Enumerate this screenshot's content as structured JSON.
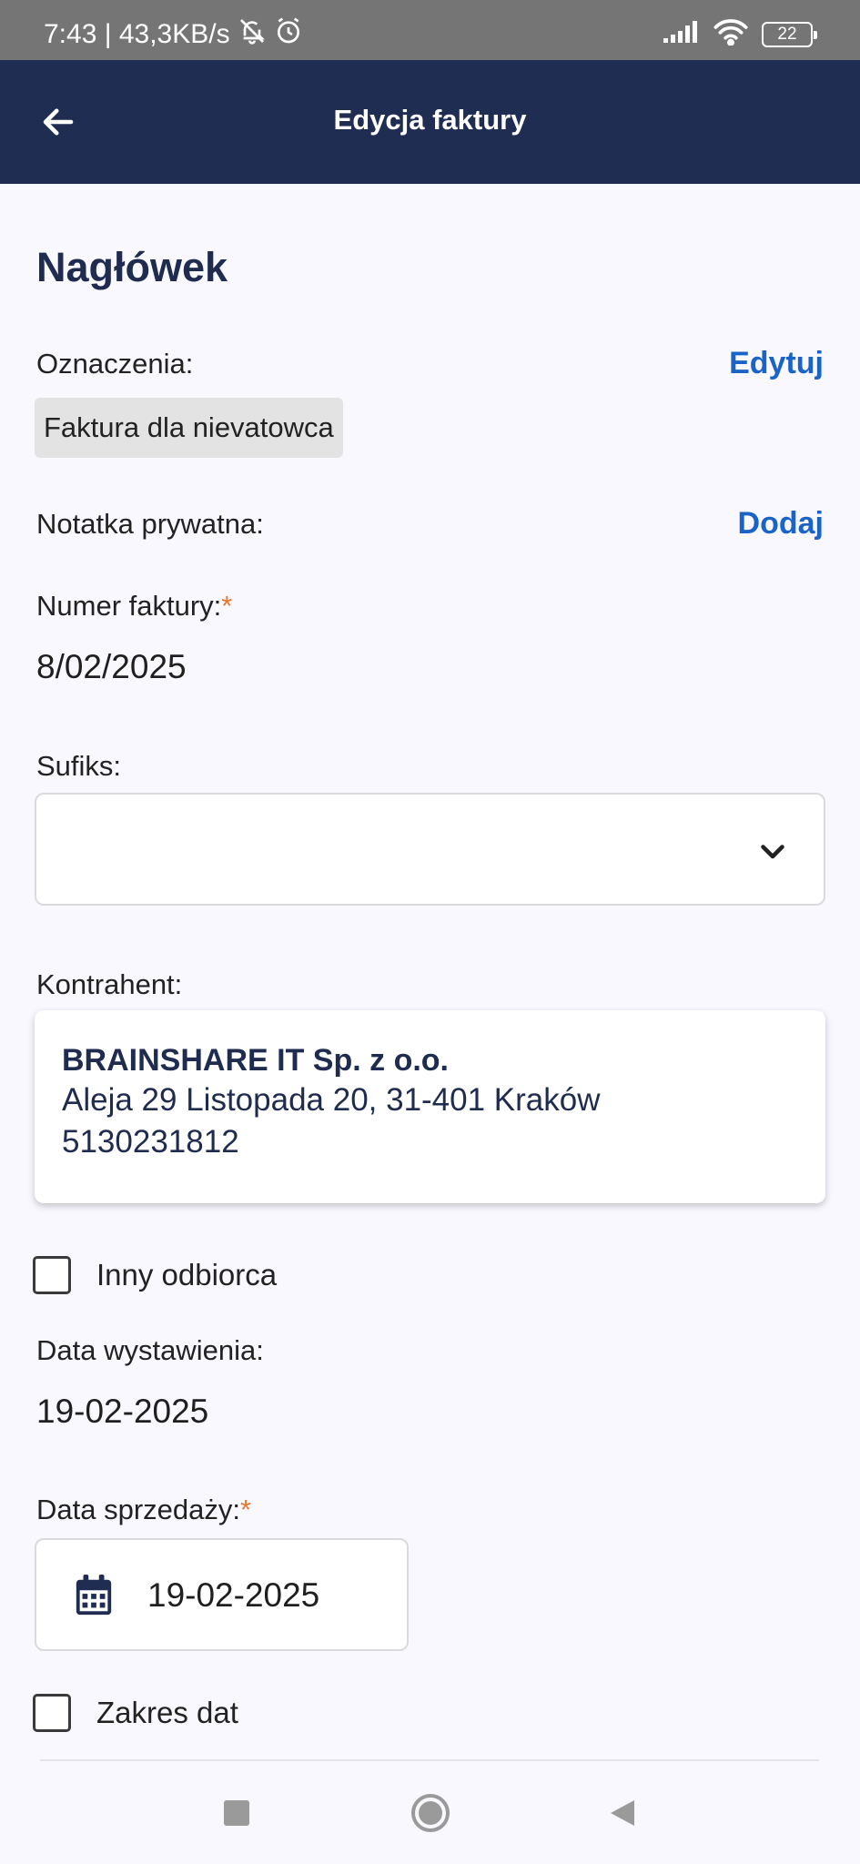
{
  "status_bar": {
    "time_speed": "7:43 | 43,3KB/s",
    "battery": "22"
  },
  "appbar": {
    "title": "Edycja faktury"
  },
  "header": {
    "section_title": "Nagłówek",
    "designations_label": "Oznaczenia:",
    "designations_edit": "Edytuj",
    "designation_tag": "Faktura dla nievatowca",
    "private_note_label": "Notatka prywatna:",
    "private_note_add": "Dodaj",
    "invoice_number_label": "Numer faktury:",
    "required_mark": "*",
    "invoice_number": "8/02/2025",
    "suffix_label": "Sufiks:",
    "suffix_value": "",
    "contractor_label": "Kontrahent:",
    "contractor": {
      "name": "BRAINSHARE IT Sp. z o.o.",
      "address": "Aleja 29 Listopada 20, 31-401 Kraków",
      "nip": "5130231812"
    },
    "other_recipient_label": "Inny odbiorca",
    "other_recipient_checked": false,
    "issue_date_label": "Data wystawienia:",
    "issue_date": "19-02-2025",
    "sale_date_label": "Data sprzedaży:",
    "sale_date": "19-02-2025",
    "date_range_label": "Zakres dat",
    "date_range_checked": false
  },
  "colors": {
    "appbar": "#202d52",
    "accent_link": "#1a63c9",
    "required": "#e8772e",
    "heading": "#1f2b4f"
  },
  "icons": [
    "silent-bell-icon",
    "alarm-icon",
    "signal-icon",
    "wifi-icon",
    "battery-icon",
    "back-arrow-icon",
    "chevron-down-icon",
    "calendar-icon",
    "nav-square-icon",
    "nav-home-icon",
    "nav-back-icon"
  ]
}
